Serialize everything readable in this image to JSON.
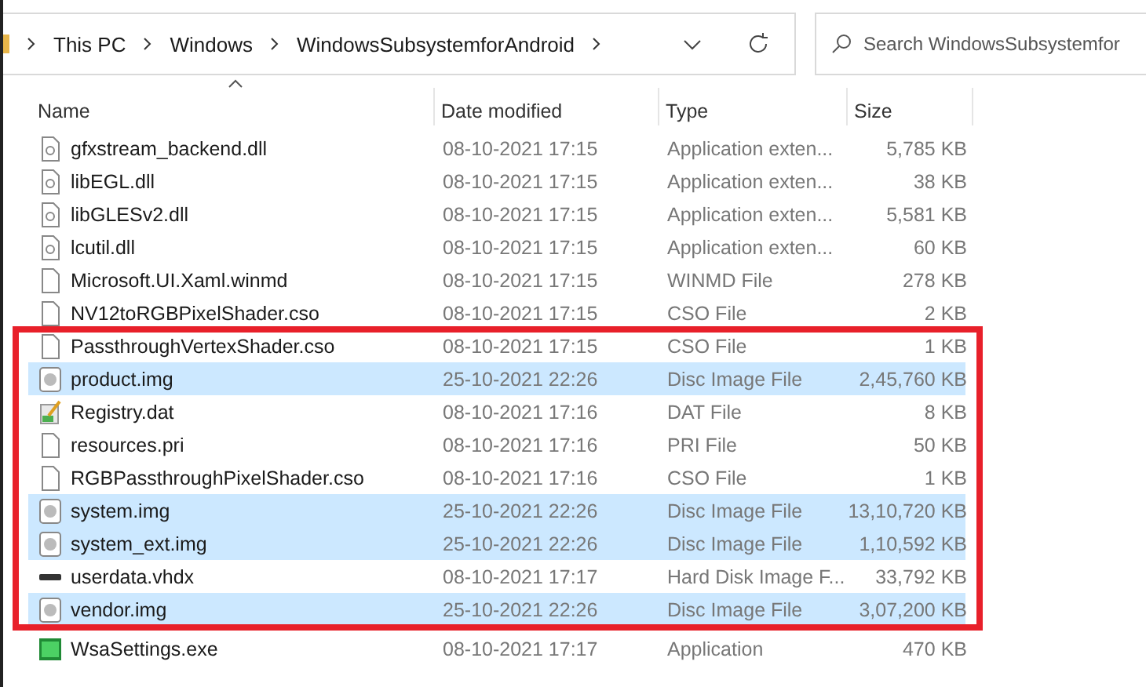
{
  "address_bar": {
    "crumbs": [
      "This PC",
      "Windows",
      "WindowsSubsystemforAndroid"
    ]
  },
  "search": {
    "placeholder": "Search WindowsSubsystemfor"
  },
  "table": {
    "columns": [
      "Name",
      "Date modified",
      "Type",
      "Size"
    ],
    "rows": [
      {
        "name": "gfxstream_backend.dll",
        "date": "08-10-2021 17:15",
        "type": "Application exten...",
        "size": "5,785 KB",
        "kind": "dll",
        "selected": false
      },
      {
        "name": "libEGL.dll",
        "date": "08-10-2021 17:15",
        "type": "Application exten...",
        "size": "38 KB",
        "kind": "dll",
        "selected": false
      },
      {
        "name": "libGLESv2.dll",
        "date": "08-10-2021 17:15",
        "type": "Application exten...",
        "size": "5,581 KB",
        "kind": "dll",
        "selected": false
      },
      {
        "name": "lcutil.dll",
        "date": "08-10-2021 17:15",
        "type": "Application exten...",
        "size": "60 KB",
        "kind": "dll",
        "selected": false
      },
      {
        "name": "Microsoft.UI.Xaml.winmd",
        "date": "08-10-2021 17:15",
        "type": "WINMD File",
        "size": "278 KB",
        "kind": "page",
        "selected": false
      },
      {
        "name": "NV12toRGBPixelShader.cso",
        "date": "08-10-2021 17:15",
        "type": "CSO File",
        "size": "2 KB",
        "kind": "page",
        "selected": false
      },
      {
        "name": "PassthroughVertexShader.cso",
        "date": "08-10-2021 17:15",
        "type": "CSO File",
        "size": "1 KB",
        "kind": "page",
        "selected": false
      },
      {
        "name": "product.img",
        "date": "25-10-2021 22:26",
        "type": "Disc Image File",
        "size": "2,45,760 KB",
        "kind": "disc",
        "selected": true
      },
      {
        "name": "Registry.dat",
        "date": "08-10-2021 17:16",
        "type": "DAT File",
        "size": "8 KB",
        "kind": "dat",
        "selected": false
      },
      {
        "name": "resources.pri",
        "date": "08-10-2021 17:16",
        "type": "PRI File",
        "size": "50 KB",
        "kind": "page",
        "selected": false
      },
      {
        "name": "RGBPassthroughPixelShader.cso",
        "date": "08-10-2021 17:16",
        "type": "CSO File",
        "size": "1 KB",
        "kind": "page",
        "selected": false
      },
      {
        "name": "system.img",
        "date": "25-10-2021 22:26",
        "type": "Disc Image File",
        "size": "13,10,720 KB",
        "kind": "disc",
        "selected": true
      },
      {
        "name": "system_ext.img",
        "date": "25-10-2021 22:26",
        "type": "Disc Image File",
        "size": "1,10,592 KB",
        "kind": "disc",
        "selected": true
      },
      {
        "name": "userdata.vhdx",
        "date": "08-10-2021 17:17",
        "type": "Hard Disk Image F...",
        "size": "33,792 KB",
        "kind": "drive",
        "selected": false
      },
      {
        "name": "vendor.img",
        "date": "25-10-2021 22:26",
        "type": "Disc Image File",
        "size": "3,07,200 KB",
        "kind": "disc",
        "selected": true
      },
      {
        "name": "WsaSettings.exe",
        "date": "08-10-2021 17:17",
        "type": "Application",
        "size": "470 KB",
        "kind": "exe",
        "selected": false
      }
    ]
  }
}
